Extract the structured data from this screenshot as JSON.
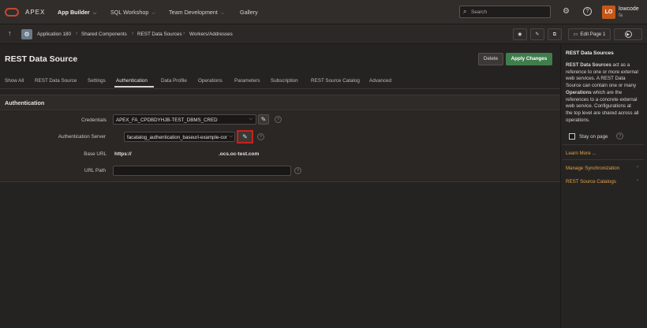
{
  "topbar": {
    "product": "APEX",
    "nav": [
      {
        "label": "App Builder"
      },
      {
        "label": "SQL Workshop"
      },
      {
        "label": "Team Development"
      },
      {
        "label": "Gallery"
      }
    ],
    "search_placeholder": "Search",
    "avatar_initials": "LO",
    "user_name": "lowcode",
    "user_sub": "fa"
  },
  "breadcrumb": {
    "items": [
      "Application 180",
      "Shared Components",
      "REST Data Sources",
      "Workers/Addresses"
    ],
    "edit_page_label": "Edit Page 1"
  },
  "header": {
    "title": "REST Data Source",
    "delete_label": "Delete",
    "apply_label": "Apply Changes"
  },
  "tabs": [
    {
      "label": "Show All"
    },
    {
      "label": "REST Data Source"
    },
    {
      "label": "Settings"
    },
    {
      "label": "Authentication"
    },
    {
      "label": "Data Profile"
    },
    {
      "label": "Operations"
    },
    {
      "label": "Parameters"
    },
    {
      "label": "Subscription"
    },
    {
      "label": "REST Source Catalog"
    },
    {
      "label": "Advanced"
    }
  ],
  "section": {
    "title": "Authentication",
    "fields": {
      "credentials_label": "Credentials",
      "credentials_value": "APEX_FA_CPDBDYHJB-TEST_DBMS_CRED",
      "auth_server_label": "Authentication Server",
      "auth_server_value": "facatalog_authentication_baseurl-example-com",
      "base_url_label": "Base URL",
      "base_url_prefix": "https://",
      "base_url_suffix": ".ocs.oc-test.com",
      "url_path_label": "URL Path",
      "url_path_value": ""
    }
  },
  "right_panel": {
    "title": "REST Data Sources",
    "description_bold": "REST Data Sources",
    "description_1": " act as a reference to one or more external web services. A REST Data Source can contain one or many ",
    "description_bold2": "Operations",
    "description_2": " which are the references to a concrete external web service. Configurations at the top level are shared across all operations.",
    "stay_on_page": "Stay on page",
    "learn_more": "Learn More ...",
    "links": [
      "Manage Synchronization",
      "REST Source Catalogs"
    ]
  },
  "colors": {
    "accent_green": "#3f7d4c",
    "highlight_red": "#c8221d",
    "link_orange": "#e2a04a",
    "avatar": "#c4581b"
  }
}
